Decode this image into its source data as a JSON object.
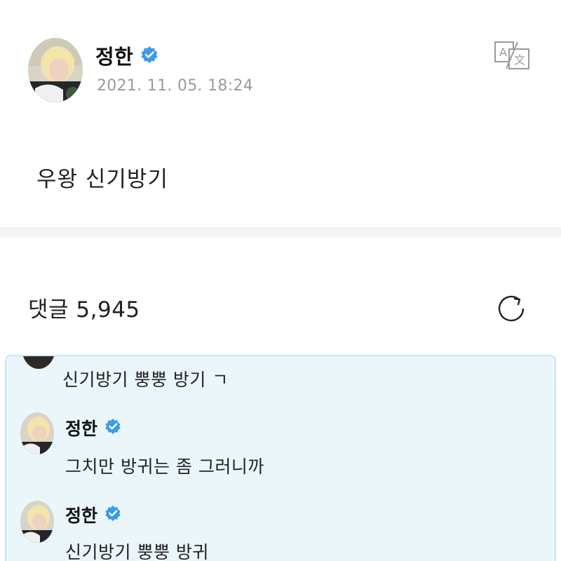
{
  "post": {
    "author": "정한",
    "date": "2021. 11. 05. 18:24",
    "text": "우왕 신기방기",
    "translate_icon": "translate-icon",
    "verified_icon": "verified-badge-icon"
  },
  "comments": {
    "label": "댓글 5,945",
    "refresh_icon": "refresh-icon"
  },
  "thread": {
    "items": [
      {
        "author": "",
        "text": "신기방기 뿡뿡 방기 ㄱ"
      },
      {
        "author": "정한",
        "verified": true,
        "text": "그치만 방귀는 좀 그러니까"
      },
      {
        "author": "정한",
        "verified": true,
        "text": "신기방기 뿡뿡 방귀"
      }
    ]
  },
  "colors": {
    "verified_blue": "#3b9be8",
    "thread_bg": "#ebf6fb",
    "thread_border": "#c9e7f3",
    "date_gray": "#9a9a9a",
    "divider": "#f3f4f6"
  }
}
